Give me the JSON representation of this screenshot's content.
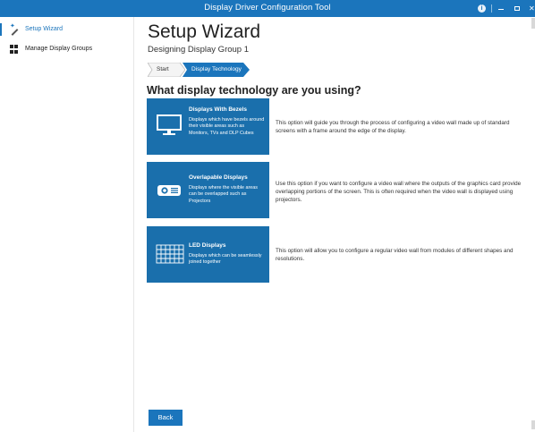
{
  "window": {
    "title": "Display Driver Configuration Tool",
    "info_glyph": "i",
    "close_glyph": "✕"
  },
  "sidebar": {
    "items": [
      {
        "label": "Setup Wizard",
        "icon": "wand-icon",
        "active": true
      },
      {
        "label": "Manage Display Groups",
        "icon": "grid-icon",
        "active": false
      }
    ]
  },
  "main": {
    "title": "Setup Wizard",
    "subtitle": "Designing Display Group 1",
    "breadcrumb": [
      "Start",
      "Display Technology"
    ],
    "question": "What display technology are you using?",
    "options": [
      {
        "icon": "monitor-icon",
        "title": "Displays With Bezels",
        "desc": "Displays which have bezels around their visible areas such as Monitors, TVs and DLP Cubes",
        "text": "This option will guide you through the process of configuring a video wall made up of standard screens with a frame around the edge of the display."
      },
      {
        "icon": "projector-icon",
        "title": "Overlapable Displays",
        "desc": "Displays where the visible areas can be overlapped such as Projectors",
        "text": "Use this option if you want to configure a video wall where the outputs of the graphics card provide overlapping portions of the screen. This is often required when the video wall is displayed using projectors."
      },
      {
        "icon": "led-panel-icon",
        "title": "LED Displays",
        "desc": "Displays which can be seamlessly joined together",
        "text": "This option will allow you to configure a regular video wall from modules of different shapes and resolutions."
      }
    ],
    "back_label": "Back"
  },
  "colors": {
    "accent": "#1b75bc",
    "option_bg": "#1a6fac",
    "text": "#333333"
  }
}
